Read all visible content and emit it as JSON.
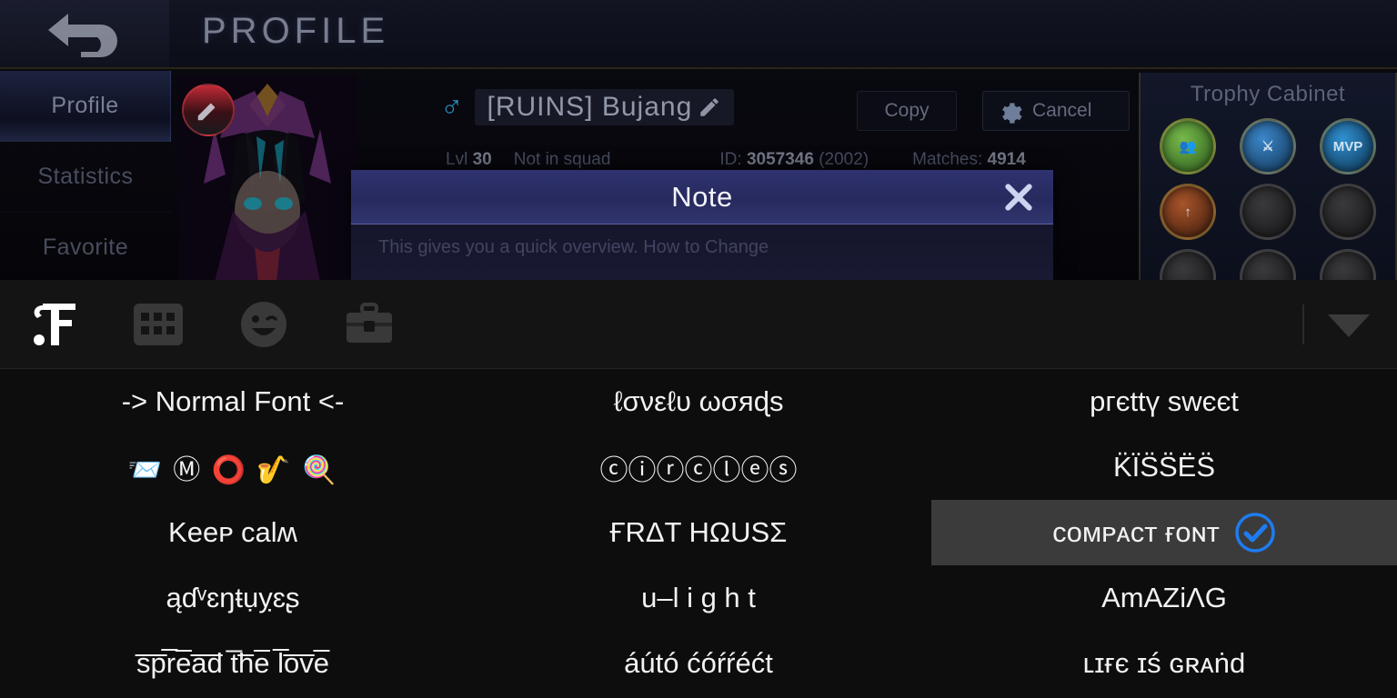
{
  "game": {
    "back_icon": "back-arrow-icon",
    "page_title": "PROFILE",
    "sidebar": {
      "items": [
        {
          "label": "Profile",
          "active": true
        },
        {
          "label": "Statistics",
          "active": false
        },
        {
          "label": "Favorite",
          "active": false
        }
      ]
    },
    "profile": {
      "gender_icon": "male-symbol",
      "gender_glyph": "♂",
      "player_name": "[RUINS] Bujang",
      "edit_icon": "pencil-icon",
      "avatar_edit_icon": "pencil-badge-icon",
      "level_label": "Lvl",
      "level_value": "30",
      "squad_status": "Not in squad",
      "id_label": "ID:",
      "id_value": "3057346",
      "id_suffix": "(2002)",
      "matches_label": "Matches:",
      "matches_value": "4914"
    },
    "buttons": {
      "copy_label": "Copy",
      "cancel_label": "Cancel",
      "gear_icon": "gear-icon"
    },
    "trophy_cabinet": {
      "title": "Trophy Cabinet",
      "badges": [
        {
          "name": "teamwork-badge",
          "glyph": "👥",
          "style": "t-green"
        },
        {
          "name": "sword-badge",
          "glyph": "⚔",
          "style": "t-blue"
        },
        {
          "name": "mvp-badge",
          "glyph": "MVP",
          "style": "t-mvp"
        },
        {
          "name": "legend-badge",
          "glyph": "↑",
          "style": "t-red"
        },
        {
          "name": "locked-badge-1",
          "glyph": "",
          "style": "t-dim"
        },
        {
          "name": "locked-badge-2",
          "glyph": "",
          "style": "t-dim"
        },
        {
          "name": "locked-badge-3",
          "glyph": "",
          "style": "t-dim"
        },
        {
          "name": "locked-badge-4",
          "glyph": "",
          "style": "t-dim"
        },
        {
          "name": "locked-badge-5",
          "glyph": "",
          "style": "t-dim"
        }
      ]
    }
  },
  "note_dialog": {
    "title": "Note",
    "close_icon": "close-x-icon",
    "body_text": "This gives you a quick overview. How to Change"
  },
  "keyboard": {
    "toolbar": [
      {
        "name": "fonts-logo-icon",
        "label": "ƒ",
        "active": true
      },
      {
        "name": "keyboard-layout-icon",
        "label": "",
        "active": false
      },
      {
        "name": "emoji-icon",
        "label": "",
        "active": false
      },
      {
        "name": "toolbox-icon",
        "label": "",
        "active": false
      }
    ],
    "collapse_icon": "chevron-down-icon",
    "accent_color": "#1e7cf0",
    "selected_bg": "#3b3b3b",
    "fonts": [
      {
        "text": "-> Normal Font <-",
        "selected": false,
        "emoji": false
      },
      {
        "text": "ℓσνεℓυ ωσяɖs",
        "selected": false,
        "emoji": false
      },
      {
        "text": "pгєttү swєєt",
        "selected": false,
        "emoji": false
      },
      {
        "text": "📨 Ⓜ ⭕ 🎷 🍭",
        "selected": false,
        "emoji": true
      },
      {
        "text": "ⓒⓘⓡⓒⓛⓔⓢ",
        "selected": false,
        "emoji": false
      },
      {
        "text": "K̈ÏS̈S̈ËS̈",
        "selected": false,
        "emoji": false
      },
      {
        "text": "Keeᴘ calʍ",
        "selected": false,
        "emoji": false
      },
      {
        "text": "ҒRΔT HΩUSΣ",
        "selected": false,
        "emoji": false
      },
      {
        "text": "ᴄᴏᴍᴘᴀᴄᴛ ғᴏɴᴛ",
        "selected": true,
        "emoji": false
      },
      {
        "text": "ąɗᵛɛŋŧụỵɛʂ",
        "selected": false,
        "emoji": false
      },
      {
        "text": "u–l i g h t",
        "selected": false,
        "emoji": false
      },
      {
        "text": "AmΑZiΛG",
        "selected": false,
        "emoji": false
      },
      {
        "text": "s̅p̅r̅e̅a̅d̅ t̅h̅e̅ l̅o̅v̅e̅",
        "selected": false,
        "emoji": false
      },
      {
        "text": "áútó ćóŕŕéćt",
        "selected": false,
        "emoji": false
      },
      {
        "text": "ʟɪғє ɪś ɢʀᴀṅd",
        "selected": false,
        "emoji": false
      }
    ]
  }
}
